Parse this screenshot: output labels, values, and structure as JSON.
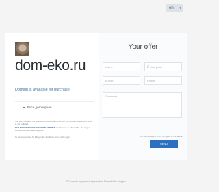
{
  "lang": {
    "current": "en"
  },
  "domain": {
    "name": "dom-eko.ru",
    "availability": "Domain is available for purchase:",
    "price_label": "Price договорная"
  },
  "notes": {
    "line1": "The price includes the guarantee's commission service, the domain registration costs is not included.",
    "line2_link": "BUY NOW THROUGH ESCROW SERVICE",
    "line2_rest": "and domain 4e URHECM - the largest Russian domain name registrar",
    "line3": "To send your offer by filling in the feedback form on the right."
  },
  "offer": {
    "title": "Your offer",
    "name_placeholder": "Name",
    "price_placeholder": "₽ Your price",
    "email_placeholder": "E-mail",
    "phone_placeholder": "Phone",
    "comment_placeholder": "Comment",
    "terms_prefix": "By submitting the form you agree to the",
    "terms_link": "Terms",
    "send_label": "SEND"
  },
  "footer": {
    "text": "© Domain is parked by service DomainParking.ru"
  }
}
